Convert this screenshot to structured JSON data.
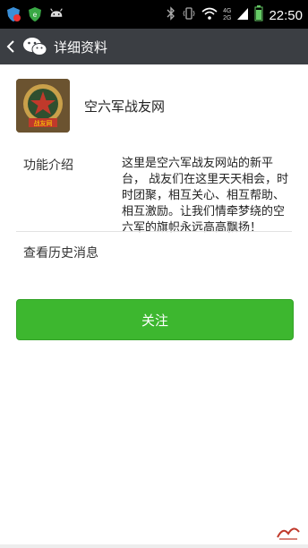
{
  "status_bar": {
    "time": "22:50",
    "network_top": "4G",
    "network_bottom": "2G"
  },
  "header": {
    "title": "详细资料"
  },
  "profile": {
    "name": "空六军战友网",
    "avatar_banner": "战友网"
  },
  "intro": {
    "label": "功能介绍",
    "text": "这里是空六军战友网站的新平台， 战友们在这里天天相会，时时团聚，相互关心、相互帮助、相互激励。让我们情牵梦绕的空六军的旗帜永远高高飘扬！"
  },
  "history": {
    "label": "查看历史消息"
  },
  "follow": {
    "label": "关注"
  },
  "colors": {
    "accent": "#3db72f",
    "actionbar": "#3b3e43"
  }
}
